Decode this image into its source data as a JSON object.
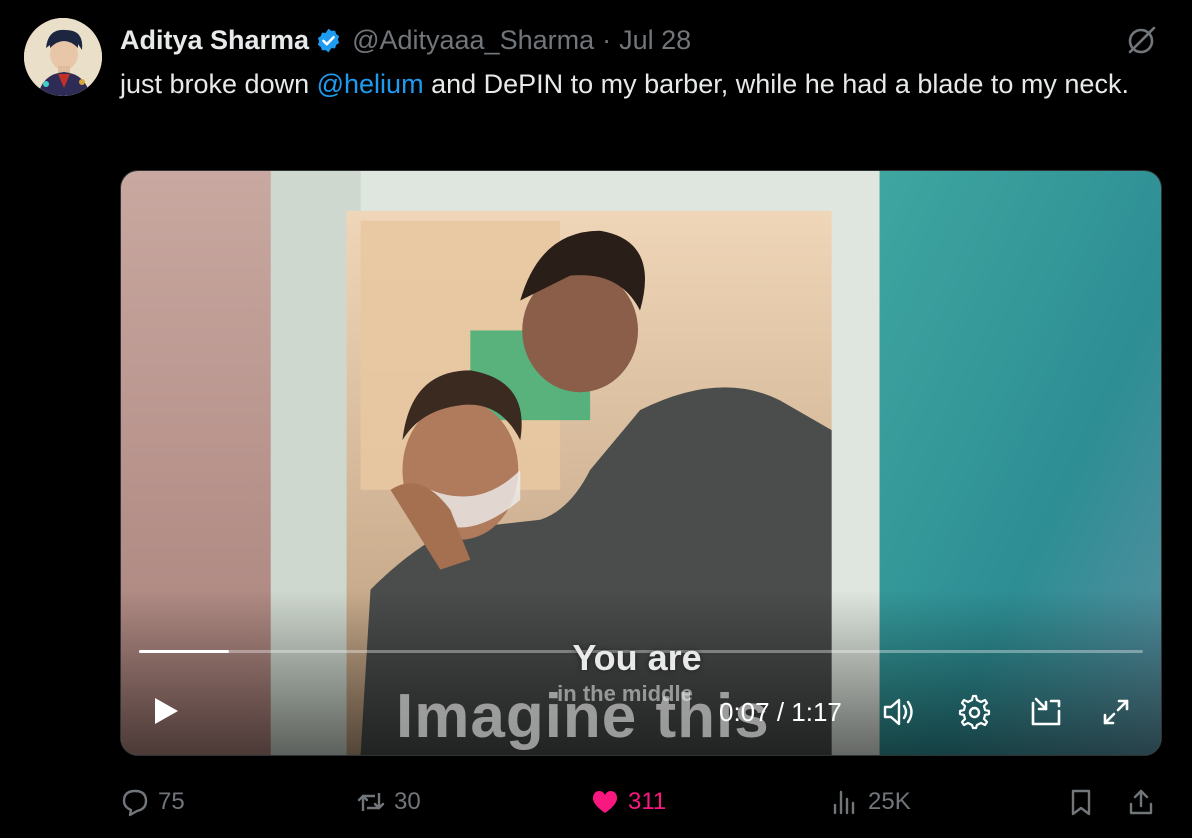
{
  "tweet": {
    "author_name": "Aditya Sharma",
    "handle": "@Adityaaa_Sharma",
    "separator": "·",
    "date": "Jul 28",
    "text_before": "just broke down ",
    "mention": "@helium",
    "text_after": " and DePIN to my barber, while he had a blade to my neck."
  },
  "video": {
    "caption_line1": "You are",
    "caption_line2": "in the middle",
    "caption_overlay": "Imagine this",
    "current_time": "0:07",
    "time_separator": " / ",
    "duration": "1:17",
    "progress_fraction": 0.09
  },
  "actions": {
    "replies": "75",
    "reposts": "30",
    "likes": "311",
    "views": "25K"
  },
  "colors": {
    "accent": "#1d9bf0",
    "like": "#f91880",
    "muted": "#71767b",
    "background": "#000000"
  },
  "icons": [
    "verified-badge-icon",
    "grok-icon",
    "play-icon",
    "volume-icon",
    "settings-icon",
    "pip-icon",
    "fullscreen-icon",
    "reply-icon",
    "repost-icon",
    "heart-icon",
    "views-icon",
    "bookmark-icon",
    "share-icon"
  ]
}
